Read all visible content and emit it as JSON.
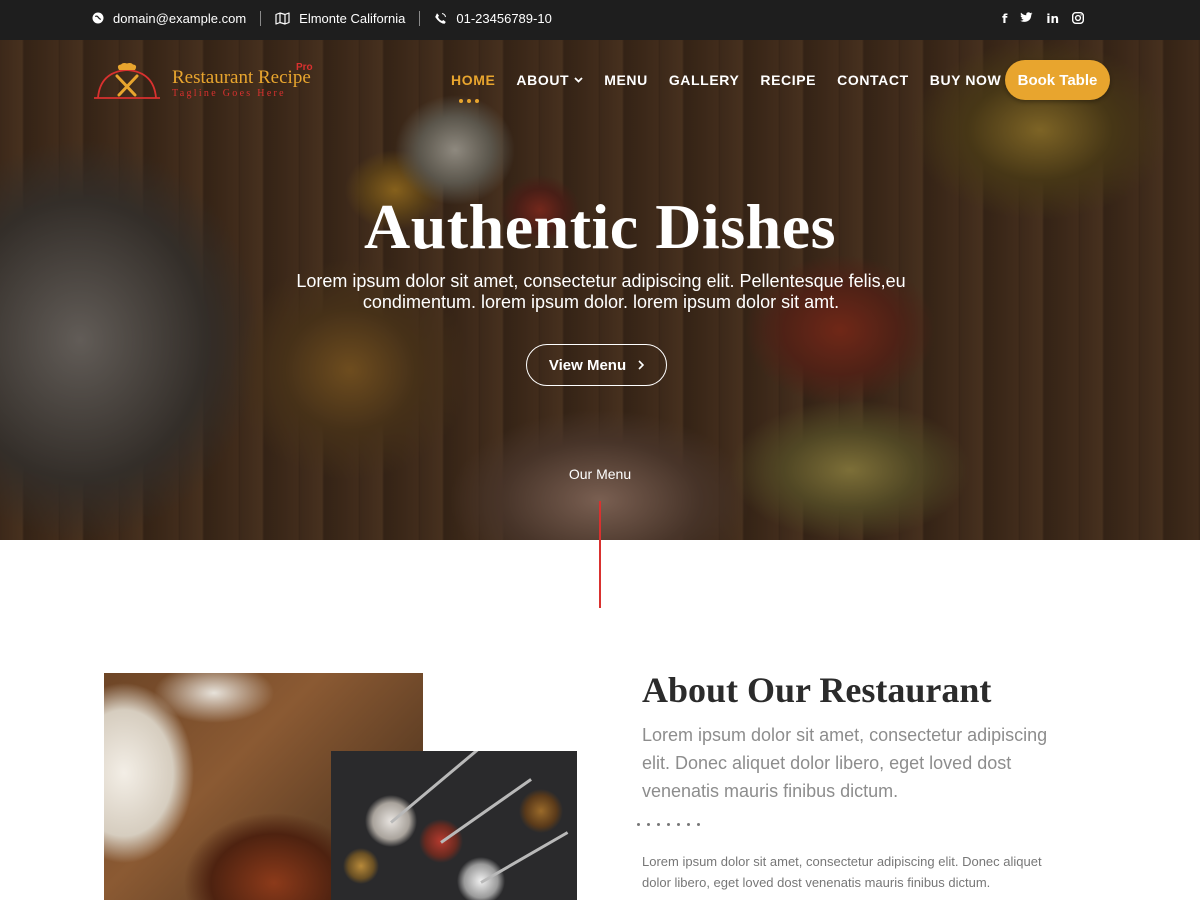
{
  "topbar": {
    "email": "domain@example.com",
    "location": "Elmonte California",
    "phone": "01-23456789-10",
    "social": [
      {
        "icon": "facebook-icon",
        "glyph": "f"
      },
      {
        "icon": "twitter-icon",
        "glyph": "t"
      },
      {
        "icon": "linkedin-icon",
        "glyph": "in"
      },
      {
        "icon": "instagram-icon",
        "glyph": ""
      }
    ]
  },
  "logo": {
    "name": "Restaurant Recipe",
    "badge": "Pro",
    "tagline": "Tagline Goes Here"
  },
  "nav": {
    "items": [
      {
        "label": "HOME",
        "active": true
      },
      {
        "label": "ABOUT",
        "dropdown": true
      },
      {
        "label": "MENU"
      },
      {
        "label": "GALLERY"
      },
      {
        "label": "RECIPE"
      },
      {
        "label": "CONTACT"
      },
      {
        "label": "BUY NOW"
      }
    ],
    "cta": "Book Table"
  },
  "hero": {
    "title": "Authentic Dishes",
    "subtitle": "Lorem ipsum dolor sit amet, consectetur adipiscing elit. Pellentesque felis,eu condimentum. lorem ipsum dolor. lorem ipsum dolor sit amt.",
    "button": "View Menu",
    "scroll_label": "Our Menu"
  },
  "about": {
    "title": "About Our Restaurant",
    "lead": "Lorem ipsum dolor sit amet, consectetur adipiscing elit. Donec aliquet dolor libero, eget loved dost venenatis mauris finibus dictum.",
    "body": "Lorem ipsum dolor sit amet, consectetur adipiscing elit. Donec aliquet dolor libero, eget loved dost venenatis mauris finibus dictum."
  },
  "colors": {
    "accent": "#e8a52e",
    "brand_red": "#d9312f",
    "topbar_bg": "#1e1e1e"
  }
}
